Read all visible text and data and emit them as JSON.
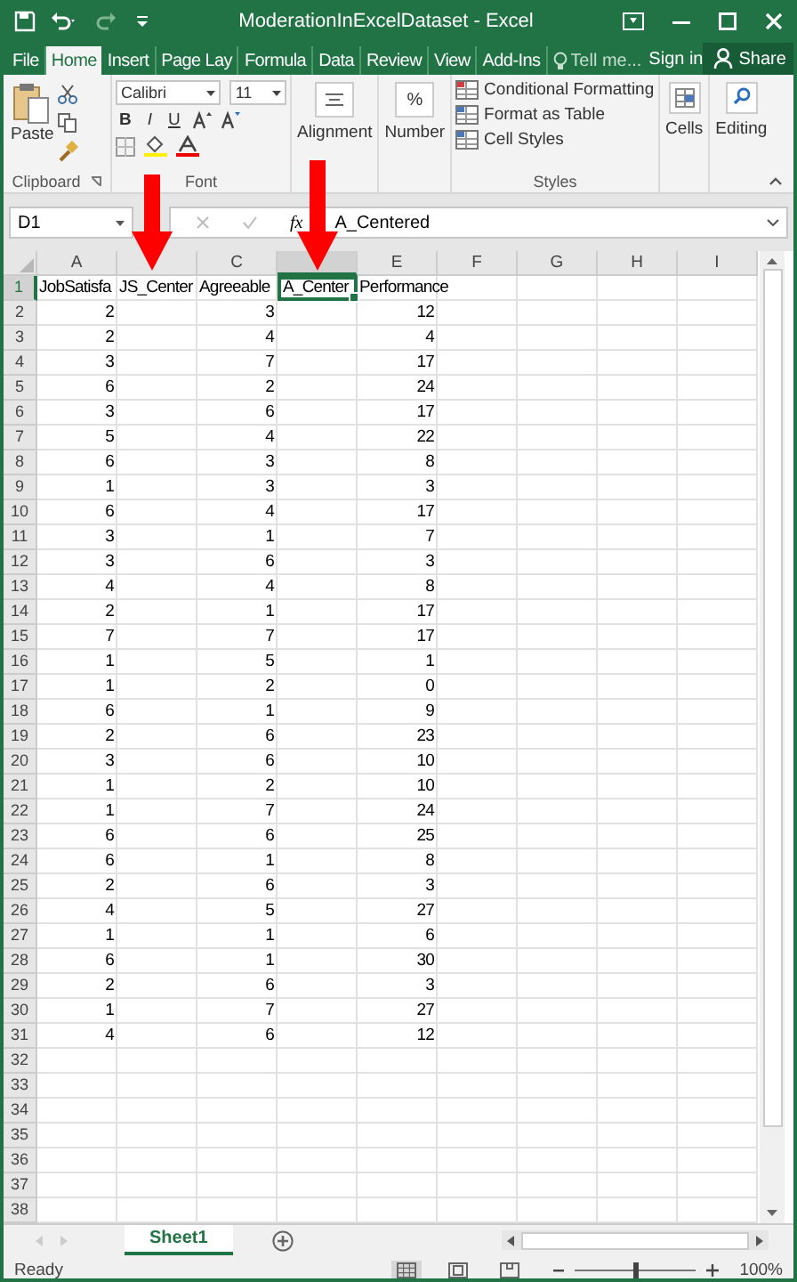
{
  "window": {
    "title": "ModerationInExcelDataset - Excel"
  },
  "tabs": [
    {
      "label": "File",
      "selected": false
    },
    {
      "label": "Home",
      "selected": true
    },
    {
      "label": "Insert",
      "selected": false
    },
    {
      "label": "Page Lay",
      "selected": false
    },
    {
      "label": "Formula",
      "selected": false
    },
    {
      "label": "Data",
      "selected": false
    },
    {
      "label": "Review",
      "selected": false
    },
    {
      "label": "View",
      "selected": false
    },
    {
      "label": "Add-Ins",
      "selected": false
    }
  ],
  "tell_me": {
    "placeholder": "Tell me..."
  },
  "sign_in": "Sign in",
  "share": "Share",
  "ribbon": {
    "clipboard": {
      "paste": "Paste",
      "label": "Clipboard"
    },
    "font": {
      "name": "Calibri",
      "size": "11",
      "bold": "B",
      "italic": "I",
      "underline": "U",
      "label": "Font"
    },
    "alignment": "Alignment",
    "number": {
      "symbol": "%",
      "label": "Number"
    },
    "styles": {
      "items": [
        "Conditional Formatting",
        "Format as Table",
        "Cell Styles"
      ],
      "label": "Styles"
    },
    "cells": "Cells",
    "editing": "Editing"
  },
  "formula_bar": {
    "name_box": "D1",
    "fx": "fx",
    "value": "A_Centered"
  },
  "sheet": {
    "columns": [
      {
        "label": "A",
        "selected": false
      },
      {
        "selected": false
      },
      {
        "label": "C",
        "selected": false
      },
      {
        "selected": true
      },
      {
        "label": "E",
        "selected": false
      },
      {
        "label": "F",
        "selected": false
      },
      {
        "label": "G",
        "selected": false
      },
      {
        "label": "H",
        "selected": false
      },
      {
        "label": "I",
        "selected": false
      }
    ],
    "rows": [
      {
        "number": "1",
        "selected": true,
        "kind": "text",
        "cells": [
          "JobSatisfa",
          "JS_Center",
          "Agreeable",
          "A_Center",
          "Performance"
        ]
      },
      {
        "number": "2",
        "selected": false,
        "kind": "number",
        "cells": [
          "2",
          null,
          "3",
          null,
          "12"
        ]
      },
      {
        "number": "3",
        "selected": false,
        "kind": "number",
        "cells": [
          "2",
          null,
          "4",
          null,
          "4"
        ]
      },
      {
        "number": "4",
        "selected": false,
        "kind": "number",
        "cells": [
          "3",
          null,
          "7",
          null,
          "17"
        ]
      },
      {
        "number": "5",
        "selected": false,
        "kind": "number",
        "cells": [
          "6",
          null,
          "2",
          null,
          "24"
        ]
      },
      {
        "number": "6",
        "selected": false,
        "kind": "number",
        "cells": [
          "3",
          null,
          "6",
          null,
          "17"
        ]
      },
      {
        "number": "7",
        "selected": false,
        "kind": "number",
        "cells": [
          "5",
          null,
          "4",
          null,
          "22"
        ]
      },
      {
        "number": "8",
        "selected": false,
        "kind": "number",
        "cells": [
          "6",
          null,
          "3",
          null,
          "8"
        ]
      },
      {
        "number": "9",
        "selected": false,
        "kind": "number",
        "cells": [
          "1",
          null,
          "3",
          null,
          "3"
        ]
      },
      {
        "number": "10",
        "selected": false,
        "kind": "number",
        "cells": [
          "6",
          null,
          "4",
          null,
          "17"
        ]
      },
      {
        "number": "11",
        "selected": false,
        "kind": "number",
        "cells": [
          "3",
          null,
          "1",
          null,
          "7"
        ]
      },
      {
        "number": "12",
        "selected": false,
        "kind": "number",
        "cells": [
          "3",
          null,
          "6",
          null,
          "3"
        ]
      },
      {
        "number": "13",
        "selected": false,
        "kind": "number",
        "cells": [
          "4",
          null,
          "4",
          null,
          "8"
        ]
      },
      {
        "number": "14",
        "selected": false,
        "kind": "number",
        "cells": [
          "2",
          null,
          "1",
          null,
          "17"
        ]
      },
      {
        "number": "15",
        "selected": false,
        "kind": "number",
        "cells": [
          "7",
          null,
          "7",
          null,
          "17"
        ]
      },
      {
        "number": "16",
        "selected": false,
        "kind": "number",
        "cells": [
          "1",
          null,
          "5",
          null,
          "1"
        ]
      },
      {
        "number": "17",
        "selected": false,
        "kind": "number",
        "cells": [
          "1",
          null,
          "2",
          null,
          "0"
        ]
      },
      {
        "number": "18",
        "selected": false,
        "kind": "number",
        "cells": [
          "6",
          null,
          "1",
          null,
          "9"
        ]
      },
      {
        "number": "19",
        "selected": false,
        "kind": "number",
        "cells": [
          "2",
          null,
          "6",
          null,
          "23"
        ]
      },
      {
        "number": "20",
        "selected": false,
        "kind": "number",
        "cells": [
          "3",
          null,
          "6",
          null,
          "10"
        ]
      },
      {
        "number": "21",
        "selected": false,
        "kind": "number",
        "cells": [
          "1",
          null,
          "2",
          null,
          "10"
        ]
      },
      {
        "number": "22",
        "selected": false,
        "kind": "number",
        "cells": [
          "1",
          null,
          "7",
          null,
          "24"
        ]
      },
      {
        "number": "23",
        "selected": false,
        "kind": "number",
        "cells": [
          "6",
          null,
          "6",
          null,
          "25"
        ]
      },
      {
        "number": "24",
        "selected": false,
        "kind": "number",
        "cells": [
          "6",
          null,
          "1",
          null,
          "8"
        ]
      },
      {
        "number": "25",
        "selected": false,
        "kind": "number",
        "cells": [
          "2",
          null,
          "6",
          null,
          "3"
        ]
      },
      {
        "number": "26",
        "selected": false,
        "kind": "number",
        "cells": [
          "4",
          null,
          "5",
          null,
          "27"
        ]
      },
      {
        "number": "27",
        "selected": false,
        "kind": "number",
        "cells": [
          "1",
          null,
          "1",
          null,
          "6"
        ]
      },
      {
        "number": "28",
        "selected": false,
        "kind": "number",
        "cells": [
          "6",
          null,
          "1",
          null,
          "30"
        ]
      },
      {
        "number": "29",
        "selected": false,
        "kind": "number",
        "cells": [
          "2",
          null,
          "6",
          null,
          "3"
        ]
      },
      {
        "number": "30",
        "selected": false,
        "kind": "number",
        "cells": [
          "1",
          null,
          "7",
          null,
          "27"
        ]
      },
      {
        "number": "31",
        "selected": false,
        "kind": "number",
        "cells": [
          "4",
          null,
          "6",
          null,
          "12"
        ]
      },
      {
        "number": "32",
        "selected": false
      },
      {
        "number": "33",
        "selected": false
      },
      {
        "number": "34",
        "selected": false
      },
      {
        "number": "35",
        "selected": false
      },
      {
        "number": "36",
        "selected": false
      },
      {
        "number": "37",
        "selected": false
      },
      {
        "number": "38",
        "selected": false
      }
    ]
  },
  "sheet_tabs": [
    {
      "label": "Sheet1",
      "selected": true
    }
  ],
  "status_bar": {
    "status": "Ready",
    "zoom": {
      "level": 0.5,
      "reading": "100%"
    }
  }
}
